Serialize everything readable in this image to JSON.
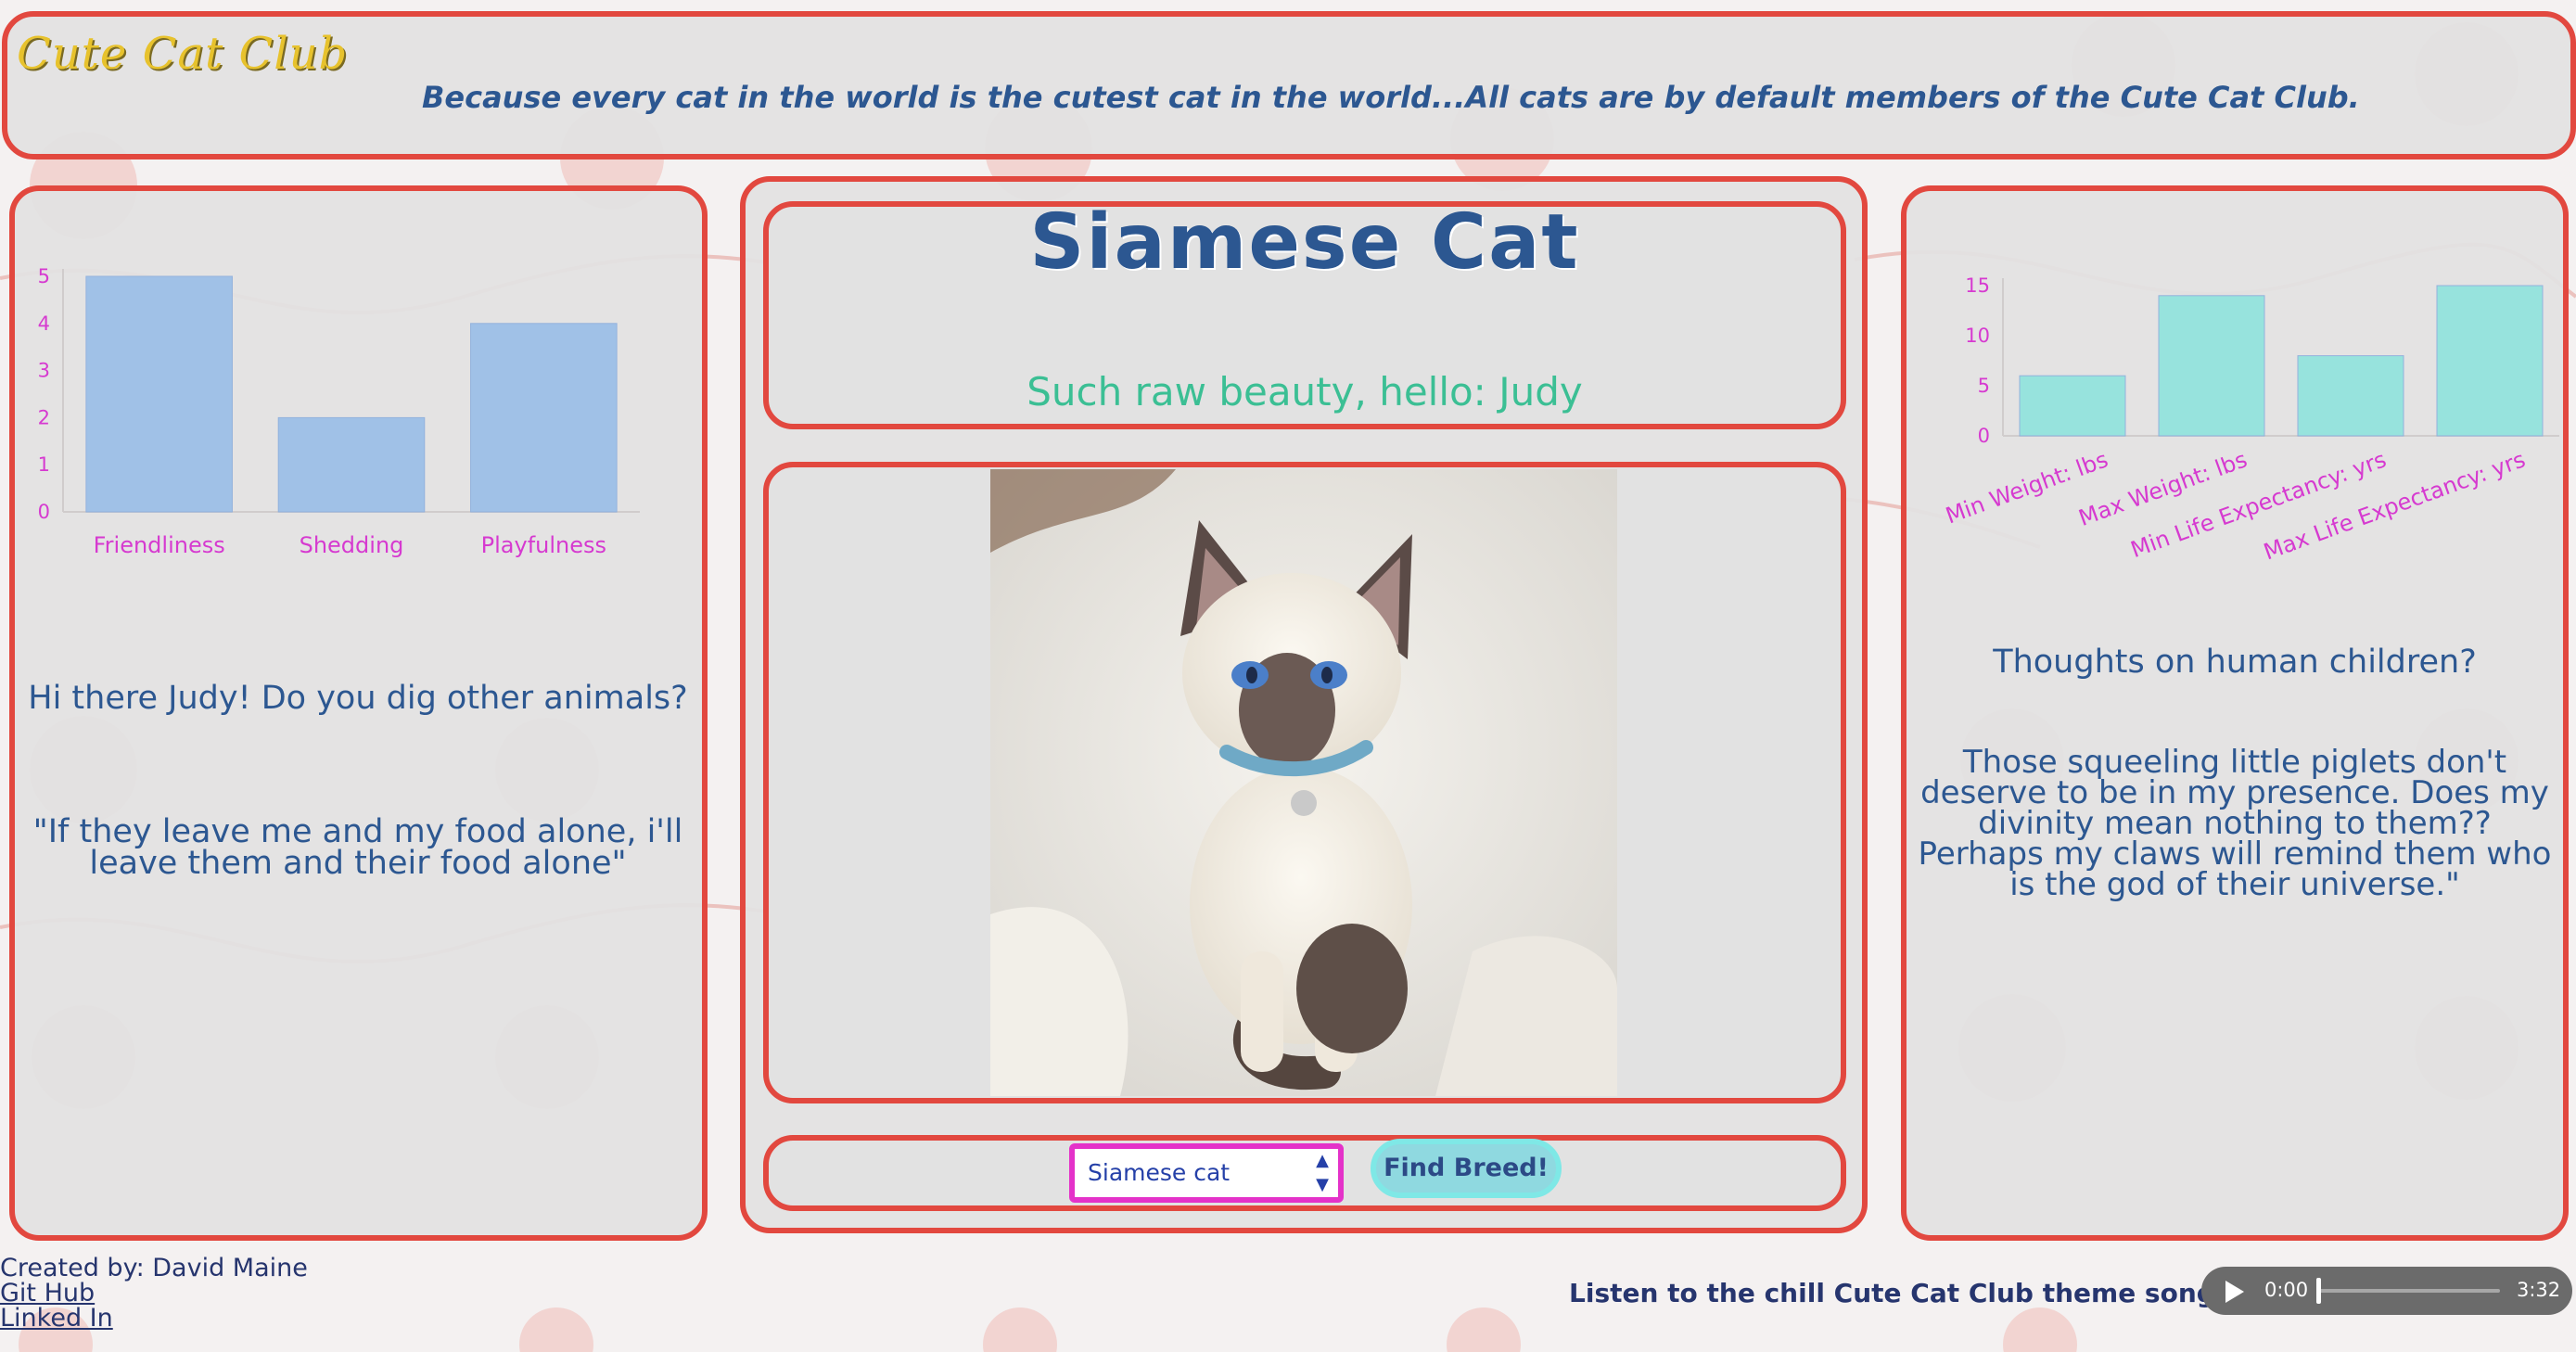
{
  "header": {
    "site_title": "Cute Cat Club",
    "tagline": "Because every cat in the world is the cutest cat in the world...All cats are by default members of the Cute Cat Club."
  },
  "breed": {
    "name": "Siamese Cat",
    "greeting": "Such raw beauty, hello: Judy"
  },
  "form": {
    "selected_breed": "Siamese cat",
    "find_button": "Find Breed!"
  },
  "left_panel": {
    "question": "Hi there Judy! Do you dig other animals?",
    "answer": "\"If they leave me and my food alone, i'll leave them and their food alone\""
  },
  "right_panel": {
    "question": "Thoughts on human children?",
    "answer": "Those squeeling little piglets don't deserve to be in my presence. Does my divinity mean nothing to them?? Perhaps my claws will remind them who is the god of their universe.\""
  },
  "footer": {
    "credit": "Created by: David Maine",
    "github": "Git Hub",
    "linkedin": "Linked In",
    "song_prompt": "Listen to the chill Cute Cat Club theme song! =>",
    "audio_current": "0:00",
    "audio_total": "3:32"
  },
  "chart_data": [
    {
      "type": "bar",
      "categories": [
        "Friendliness",
        "Shedding",
        "Playfulness"
      ],
      "values": [
        5,
        2,
        4
      ],
      "ylim": [
        0,
        5
      ],
      "yticks": [
        0,
        1,
        2,
        3,
        4,
        5
      ],
      "color": "#9dc0e8"
    },
    {
      "type": "bar",
      "categories": [
        "Min Weight: lbs",
        "Max Weight: lbs",
        "Min Life Expectancy: yrs",
        "Max Life Expectancy: yrs"
      ],
      "values": [
        6,
        14,
        8,
        15
      ],
      "ylim": [
        0,
        15
      ],
      "yticks": [
        0,
        5,
        10,
        15
      ],
      "color": "#93e3dd"
    }
  ],
  "colors": {
    "panel_border": "#e2483f",
    "heading": "#2c5791",
    "greeting": "#3bbf94",
    "axis_labels": "#d63ad0",
    "title_gold": "#e7c22d"
  }
}
